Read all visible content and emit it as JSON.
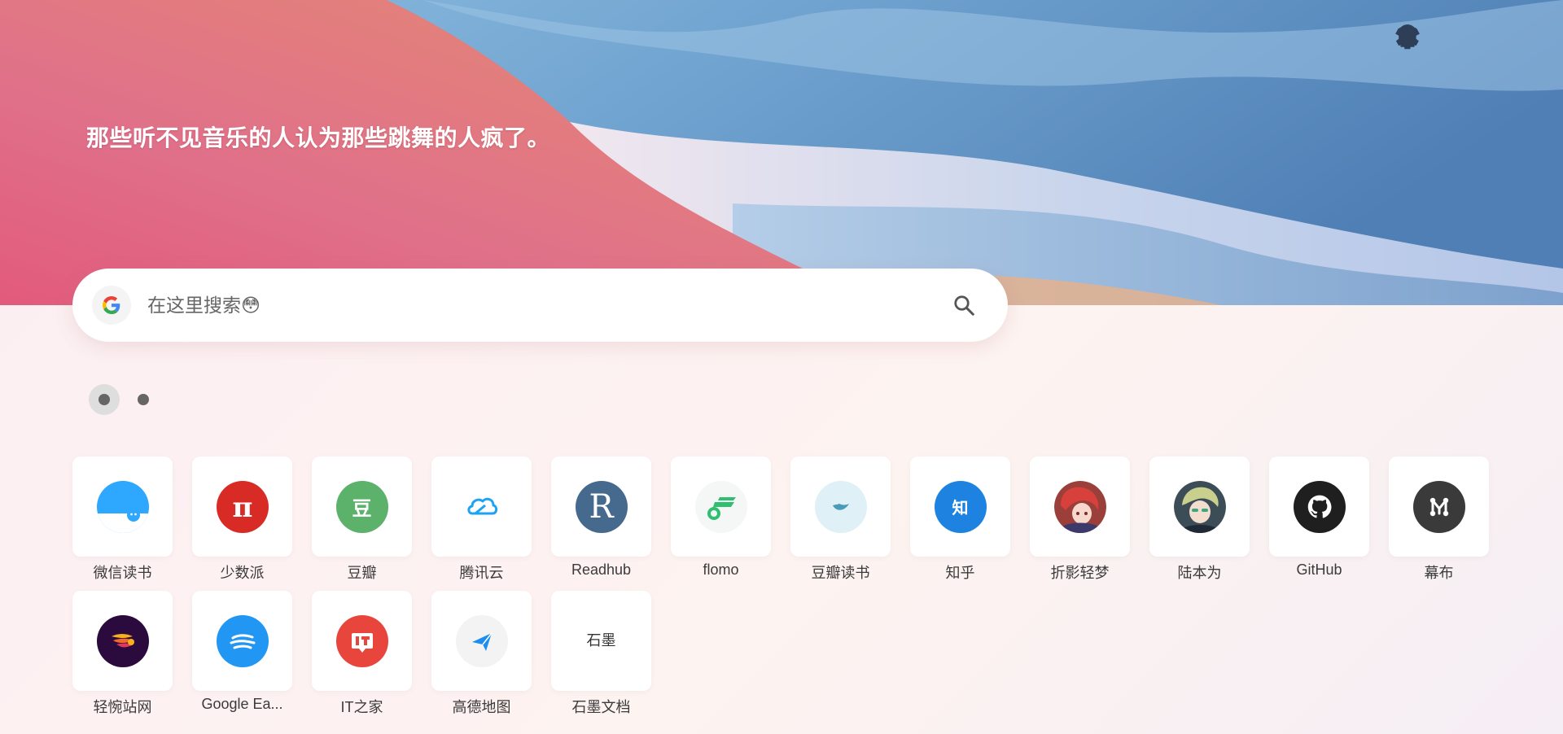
{
  "header": {
    "quote": "那些听不见音乐的人认为那些跳舞的人疯了。",
    "icons": [
      "shirt-icon",
      "lightbulb-icon",
      "gear-icon"
    ]
  },
  "search": {
    "placeholder": "在这里搜索😳",
    "value": "",
    "engine_icon": "google-icon",
    "submit_icon": "search-icon"
  },
  "pagination": {
    "pages": 2,
    "active_index": 0
  },
  "shortcuts": [
    {
      "label": "微信读书",
      "icon": "weread-icon",
      "color": "#2ea7ff"
    },
    {
      "label": "少数派",
      "icon": "sspai-icon",
      "color": "#d92b26"
    },
    {
      "label": "豆瓣",
      "icon": "douban-icon",
      "color": "#5cb26a",
      "glyph": "豆"
    },
    {
      "label": "腾讯云",
      "icon": "tencent-cloud-icon",
      "color": "#1ba3f5"
    },
    {
      "label": "Readhub",
      "icon": "readhub-icon",
      "color": "#456a8e",
      "glyph": "R"
    },
    {
      "label": "flomo",
      "icon": "flomo-icon",
      "color": "#2fbf71"
    },
    {
      "label": "豆瓣读书",
      "icon": "douban-book-icon",
      "color": "#4a9bb8"
    },
    {
      "label": "知乎",
      "icon": "zhihu-icon",
      "color": "#1e83e0",
      "glyph": "知"
    },
    {
      "label": "折影轻梦",
      "icon": "zheying-avatar-icon",
      "color": "#c9453f"
    },
    {
      "label": "陆本为",
      "icon": "lubenwei-avatar-icon",
      "color": "#4d6a5f"
    },
    {
      "label": "GitHub",
      "icon": "github-icon",
      "color": "#1f1f1f"
    },
    {
      "label": "幕布",
      "icon": "mubu-icon",
      "color": "#3a3a3a"
    },
    {
      "label": "轻惋站网",
      "icon": "qingwan-icon",
      "color": "#2b0a3d"
    },
    {
      "label": "Google Ea...",
      "icon": "google-earth-icon",
      "color": "#2196f3"
    },
    {
      "label": "IT之家",
      "icon": "ithome-icon",
      "color": "#e8453c"
    },
    {
      "label": "高德地图",
      "icon": "amap-icon",
      "color": "#1d8ef0"
    },
    {
      "label": "石墨文档",
      "icon": "shimo-icon",
      "color": "#333333",
      "glyph": "石墨"
    }
  ]
}
